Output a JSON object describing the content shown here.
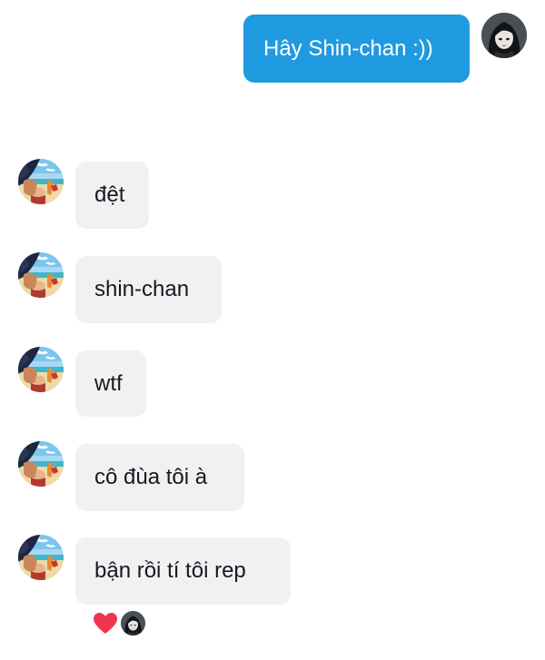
{
  "conversation": {
    "sent": [
      {
        "text": "Hây Shin-chan :))"
      }
    ],
    "received": [
      {
        "text": "đệt"
      },
      {
        "text": "shin-chan"
      },
      {
        "text": "wtf"
      },
      {
        "text": "cô đùa tôi à"
      },
      {
        "text": "bận rồi tí tôi rep"
      }
    ]
  },
  "reaction": {
    "emoji_icon": "heart-icon",
    "color": "#f0344f",
    "reactor_avatar_icon": "anime-girl-avatar-icon"
  },
  "colors": {
    "sent_bubble": "#1f9ae0",
    "received_bubble": "#f1f1f2",
    "received_text": "#161823"
  }
}
